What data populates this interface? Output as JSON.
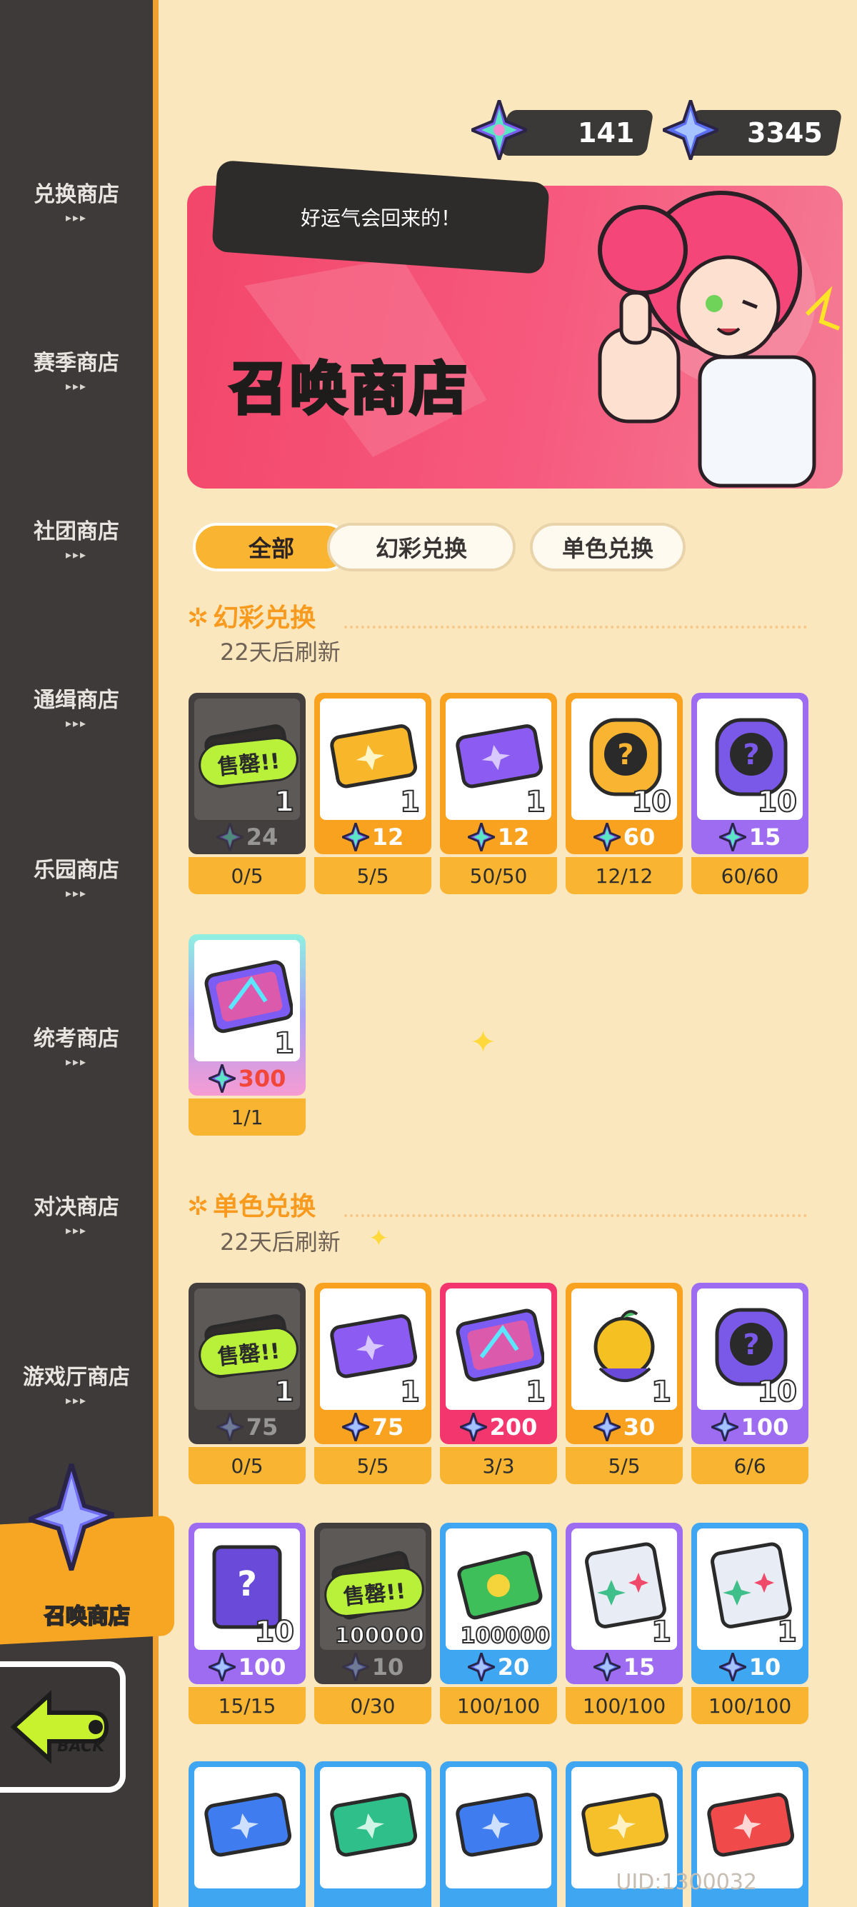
{
  "currencies": [
    {
      "name": "rainbow-star",
      "value": "141"
    },
    {
      "name": "blue-star",
      "value": "3345"
    }
  ],
  "sidebar": {
    "items": [
      {
        "label": "兑换商店"
      },
      {
        "label": "赛季商店"
      },
      {
        "label": "社团商店"
      },
      {
        "label": "通缉商店"
      },
      {
        "label": "乐园商店"
      },
      {
        "label": "统考商店"
      },
      {
        "label": "对决商店"
      },
      {
        "label": "游戏厅商店"
      }
    ],
    "active_label": "召唤商店",
    "dots": "▸▸▸",
    "back_label": "BACK"
  },
  "banner": {
    "title": "召唤商店",
    "speech": "好运气会回来的！"
  },
  "tabs": [
    {
      "label": "全部",
      "active": true
    },
    {
      "label": "幻彩兑换",
      "active": false
    },
    {
      "label": "单色兑换",
      "active": false
    }
  ],
  "sections": [
    {
      "title": "幻彩兑换",
      "subtitle": "22天后刷新",
      "rows": [
        [
          {
            "color": "soldout",
            "item": "ticket-dark-icon",
            "qty": "1",
            "price": "24",
            "currency": "rainbow",
            "limit": "0/5",
            "sold_out": true,
            "sold_label": "售罄!!"
          },
          {
            "color": "orange",
            "item": "ticket-gold-icon",
            "qty": "1",
            "price": "12",
            "currency": "rainbow",
            "limit": "5/5"
          },
          {
            "color": "orange",
            "item": "ticket-purple-icon",
            "qty": "1",
            "price": "12",
            "currency": "rainbow",
            "limit": "50/50"
          },
          {
            "color": "orange",
            "item": "mystery-token-gold-icon",
            "qty": "10",
            "price": "60",
            "currency": "rainbow",
            "limit": "12/12"
          },
          {
            "color": "purple",
            "item": "mystery-token-purple-icon",
            "qty": "10",
            "price": "15",
            "currency": "rainbow",
            "limit": "60/60"
          }
        ],
        [
          {
            "color": "rainbow",
            "item": "card-holo-icon",
            "qty": "1",
            "price": "300",
            "currency": "rainbow",
            "price_red": true,
            "limit": "1/1"
          }
        ]
      ]
    },
    {
      "title": "单色兑换",
      "subtitle": "22天后刷新",
      "rows": [
        [
          {
            "color": "soldout",
            "item": "ticket-dark-icon",
            "qty": "1",
            "price": "75",
            "currency": "blue",
            "limit": "0/5",
            "sold_out": true,
            "sold_label": "售罄!!"
          },
          {
            "color": "orange",
            "item": "ticket-purple-icon",
            "qty": "1",
            "price": "75",
            "currency": "blue",
            "limit": "5/5"
          },
          {
            "color": "pink",
            "item": "card-holo-icon",
            "qty": "1",
            "price": "200",
            "currency": "blue",
            "limit": "3/3"
          },
          {
            "color": "orange",
            "item": "golden-fruit-icon",
            "qty": "1",
            "price": "30",
            "currency": "blue",
            "limit": "5/5"
          },
          {
            "color": "purple",
            "item": "mystery-token-purple-icon",
            "qty": "10",
            "price": "100",
            "currency": "blue",
            "limit": "6/6"
          }
        ],
        [
          {
            "color": "purple",
            "item": "mystery-card-icon",
            "qty": "10",
            "price": "100",
            "currency": "blue",
            "limit": "15/15"
          },
          {
            "color": "soldout",
            "item": "cash-dark-icon",
            "qty": "100000",
            "price": "10",
            "currency": "blue",
            "limit": "0/30",
            "sold_out": true,
            "sold_label": "售罄!!"
          },
          {
            "color": "blue",
            "item": "cash-green-icon",
            "qty": "100000",
            "price": "20",
            "currency": "blue",
            "limit": "100/100"
          },
          {
            "color": "purple",
            "item": "sticker-pack-icon",
            "qty": "1",
            "price": "15",
            "currency": "blue",
            "limit": "100/100"
          },
          {
            "color": "blue",
            "item": "sticker-pack-icon",
            "qty": "1",
            "price": "10",
            "currency": "blue",
            "limit": "100/100"
          }
        ],
        [
          {
            "color": "blue",
            "item": "ticket-blue-icon",
            "partial": true
          },
          {
            "color": "blue",
            "item": "ticket-green-icon",
            "partial": true
          },
          {
            "color": "blue",
            "item": "ticket-blue-icon",
            "partial": true
          },
          {
            "color": "blue",
            "item": "ticket-yellow-icon",
            "partial": true
          },
          {
            "color": "blue",
            "item": "ticket-red-icon",
            "partial": true
          }
        ]
      ]
    }
  ],
  "uid": "UID:1300032"
}
